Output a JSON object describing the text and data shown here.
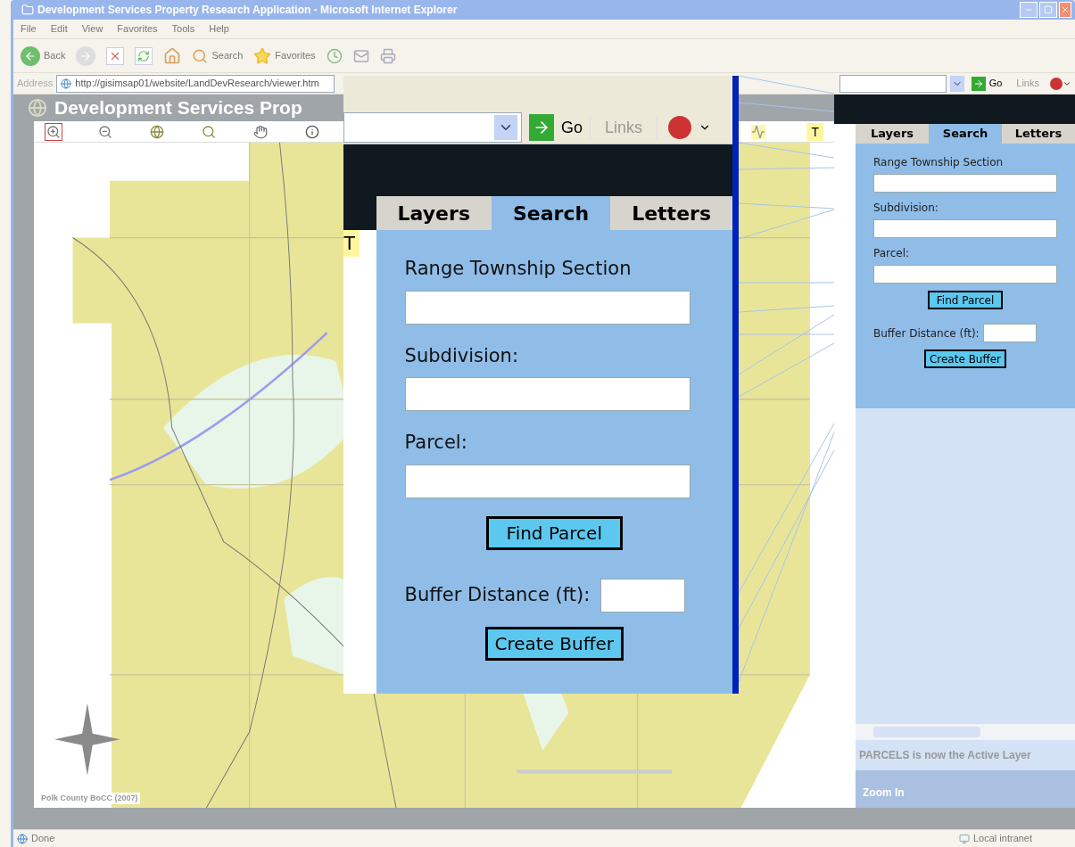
{
  "window": {
    "title": "Development Services Property Research Application - Microsoft Internet Explorer"
  },
  "menu": [
    "File",
    "Edit",
    "View",
    "Favorites",
    "Tools",
    "Help"
  ],
  "toolbar": {
    "back": "Back",
    "search": "Search",
    "favorites": "Favorites"
  },
  "address": {
    "label": "Address",
    "url": "http://gisimsap01/website/LandDevResearch/viewer.htm",
    "go": "Go",
    "links": "Links"
  },
  "page": {
    "title": "Development Services Prop",
    "credit": "Polk County BoCC (2007)"
  },
  "map_tools": [
    {
      "kind": "zoom-in",
      "selected": true
    },
    {
      "kind": "zoom-out",
      "selected": false
    },
    {
      "kind": "zoom-full",
      "selected": false
    },
    {
      "kind": "zoom-active",
      "selected": false
    },
    {
      "kind": "pan",
      "selected": false
    },
    {
      "kind": "identify",
      "selected": false
    }
  ],
  "map_tools_right": [
    {
      "kind": "line",
      "selected": false
    },
    {
      "kind": "text",
      "label": "T",
      "selected": false
    }
  ],
  "inset": {
    "go": "Go",
    "links": "Links",
    "tool_label": "T",
    "tabs": [
      {
        "label": "Layers",
        "selected": false
      },
      {
        "label": "Search",
        "selected": true
      },
      {
        "label": "Letters",
        "selected": false
      }
    ],
    "fields": [
      "Range Township Section",
      "Subdivision:",
      "Parcel:"
    ],
    "find_button": "Find Parcel",
    "buffer_label": "Buffer Distance (ft):",
    "buffer_button": "Create Buffer"
  },
  "panel": {
    "tabs": [
      {
        "label": "Layers",
        "selected": false
      },
      {
        "label": "Search",
        "selected": true
      },
      {
        "label": "Letters",
        "selected": false
      }
    ],
    "fields": [
      "Range Township Section",
      "Subdivision:",
      "Parcel:"
    ],
    "find_button": "Find Parcel",
    "buffer_label": "Buffer Distance (ft):",
    "buffer_button": "Create Buffer"
  },
  "messages": {
    "active_layer": "PARCELS is now the Active Layer",
    "tool": "Zoom In"
  },
  "status_bar": {
    "text": "Done",
    "zone": "Local intranet"
  }
}
